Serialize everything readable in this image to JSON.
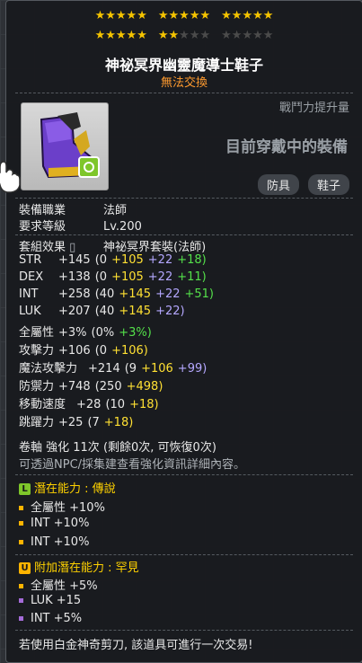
{
  "stars": {
    "row1": [
      5,
      5,
      5
    ],
    "row2_filled": 7,
    "row2_total": 15
  },
  "item": {
    "name": "神祕冥界幽靈魔導士鞋子",
    "trade": "無法交換",
    "power_label": "戰鬥力提升量",
    "equipped_text": "目前穿戴中的裝備",
    "tags": [
      "防具",
      "鞋子"
    ]
  },
  "requirements": [
    {
      "label": "裝備職業",
      "value": "法師"
    },
    {
      "label": "要求等級",
      "value": "Lv.200"
    }
  ],
  "set": {
    "label": "套組效果",
    "value": "神祕冥界套裝(法師)"
  },
  "stats": [
    {
      "label": "STR",
      "total": "+145",
      "base": "(0",
      "flame": "+105",
      "enh": "+22",
      "extra": "+18)"
    },
    {
      "label": "DEX",
      "total": "+138",
      "base": "(0",
      "flame": "+105",
      "enh": "+22",
      "extra": "+11)"
    },
    {
      "label": "INT",
      "total": "+258",
      "base": "(40",
      "flame": "+145",
      "enh": "+22",
      "extra": "+51)"
    },
    {
      "label": "LUK",
      "total": "+207",
      "base": "(40",
      "flame": "+145",
      "enh": "+22)",
      "extra": ""
    },
    {
      "label": "全屬性",
      "total": "+3%",
      "base": "(0%",
      "flame": "",
      "enh": "",
      "extra": "+3%)"
    },
    {
      "label": "攻擊力",
      "total": "+106",
      "base": "(0",
      "flame": "+106)",
      "enh": "",
      "extra": ""
    },
    {
      "label": "魔法攻擊力",
      "total": "+214",
      "base": "(9",
      "flame": "+106",
      "enh": "+99)",
      "extra": ""
    },
    {
      "label": "防禦力",
      "total": "+748",
      "base": "(250",
      "flame": "+498)",
      "enh": "",
      "extra": ""
    },
    {
      "label": "移動速度",
      "total": "+28",
      "base": "(10",
      "flame": "+18)",
      "enh": "",
      "extra": ""
    },
    {
      "label": "跳躍力",
      "total": "+25",
      "base": "(7",
      "flame": "+18)",
      "enh": "",
      "extra": ""
    }
  ],
  "scroll": "卷軸 強化 11次 (剩餘0次, 可恢復0次)",
  "npc_note": "可透過NPC/採集建查看強化資訊詳細內容。",
  "potential": {
    "badge": "L",
    "title": "潛在能力 : 傳說",
    "lines": [
      "全屬性 +10%",
      "INT +10%",
      "INT +10%"
    ]
  },
  "bonus_potential": {
    "badge": "U",
    "title": "附加潛在能力 : 罕見",
    "lines": [
      "全屬性 +5%",
      "LUK +15",
      "INT +5%"
    ]
  },
  "footer": "若使用白金神奇剪刀, 該道具可進行一次交易!",
  "colors": {
    "legend_green": "#7ec62a",
    "unique_gold": "#ffb400",
    "bullet_gold": "#ffb400",
    "bullet_purple": "#a46bd8"
  }
}
